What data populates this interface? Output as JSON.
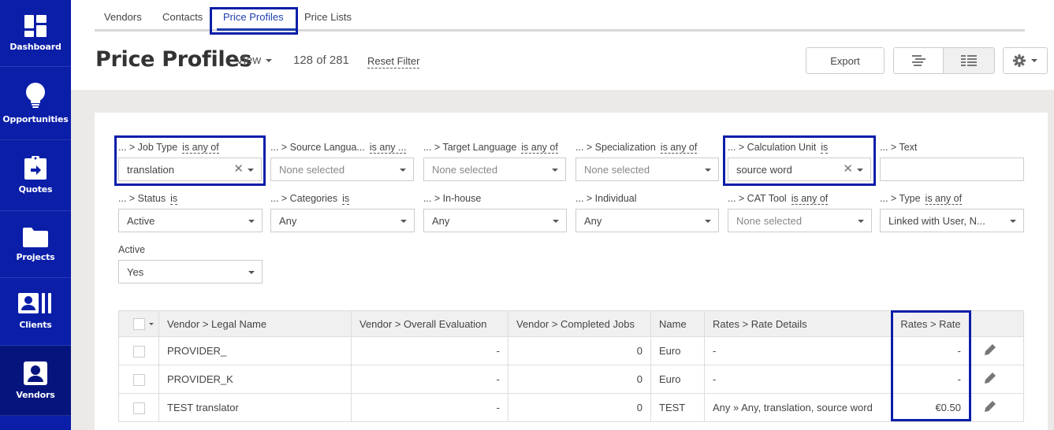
{
  "sidebar": {
    "items": [
      {
        "label": "Dashboard",
        "icon": "dashboard-icon"
      },
      {
        "label": "Opportunities",
        "icon": "lightbulb-icon"
      },
      {
        "label": "Quotes",
        "icon": "clipboard-arrow-icon"
      },
      {
        "label": "Projects",
        "icon": "folder-icon"
      },
      {
        "label": "Clients",
        "icon": "clients-icon"
      },
      {
        "label": "Vendors",
        "icon": "vendor-user-icon",
        "active": true
      }
    ]
  },
  "tabs": [
    {
      "label": "Vendors"
    },
    {
      "label": "Contacts"
    },
    {
      "label": "Price Profiles",
      "active": true
    },
    {
      "label": "Price Lists"
    }
  ],
  "header": {
    "title": "Price Profiles",
    "view_label": "View",
    "count": "128 of 281",
    "reset_filter": "Reset Filter",
    "export_label": "Export"
  },
  "filters": {
    "job_type": {
      "label": "... > Job Type",
      "op": "is any of",
      "value": "translation"
    },
    "source_language": {
      "label": "... > Source Langua...",
      "op": "is any ...",
      "value": "None selected"
    },
    "target_language": {
      "label": "... > Target Language",
      "op": "is any of",
      "value": "None selected"
    },
    "specialization": {
      "label": "... > Specialization",
      "op": "is any of",
      "value": "None selected"
    },
    "calculation_unit": {
      "label": "... > Calculation Unit",
      "op": "is",
      "value": "source word"
    },
    "text": {
      "label": "... > Text",
      "value": ""
    },
    "status": {
      "label": "... > Status",
      "op": "is",
      "value": "Active"
    },
    "categories": {
      "label": "... > Categories",
      "op": "is",
      "value": "Any"
    },
    "in_house": {
      "label": "... > In-house",
      "value": "Any"
    },
    "individual": {
      "label": "... > Individual",
      "value": "Any"
    },
    "cat_tool": {
      "label": "... > CAT Tool",
      "op": "is any of",
      "value": "None selected"
    },
    "type": {
      "label": "... > Type",
      "op": "is any of",
      "value": "Linked with User, N..."
    },
    "active": {
      "label": "Active",
      "value": "Yes"
    }
  },
  "table": {
    "columns": [
      "Vendor > Legal Name",
      "Vendor > Overall Evaluation",
      "Vendor > Completed Jobs",
      "Name",
      "Rates > Rate Details",
      "Rates > Rate"
    ],
    "rows": [
      {
        "legal_name": "PROVIDER_",
        "evaluation": "-",
        "completed_jobs": "0",
        "name": "Euro",
        "rate_details": "-",
        "rate": "-"
      },
      {
        "legal_name": "PROVIDER_K",
        "evaluation": "-",
        "completed_jobs": "0",
        "name": "Euro",
        "rate_details": "-",
        "rate": "-"
      },
      {
        "legal_name": "TEST translator",
        "evaluation": "-",
        "completed_jobs": "0",
        "name": "TEST",
        "rate_details": "Any » Any, translation, source word",
        "rate": "€0.50"
      }
    ]
  },
  "colors": {
    "sidebar": "#0a1ea8",
    "sidebar_active": "#06157e",
    "highlight": "#0a1ea8",
    "active_tab_text": "#1f3fb0"
  }
}
